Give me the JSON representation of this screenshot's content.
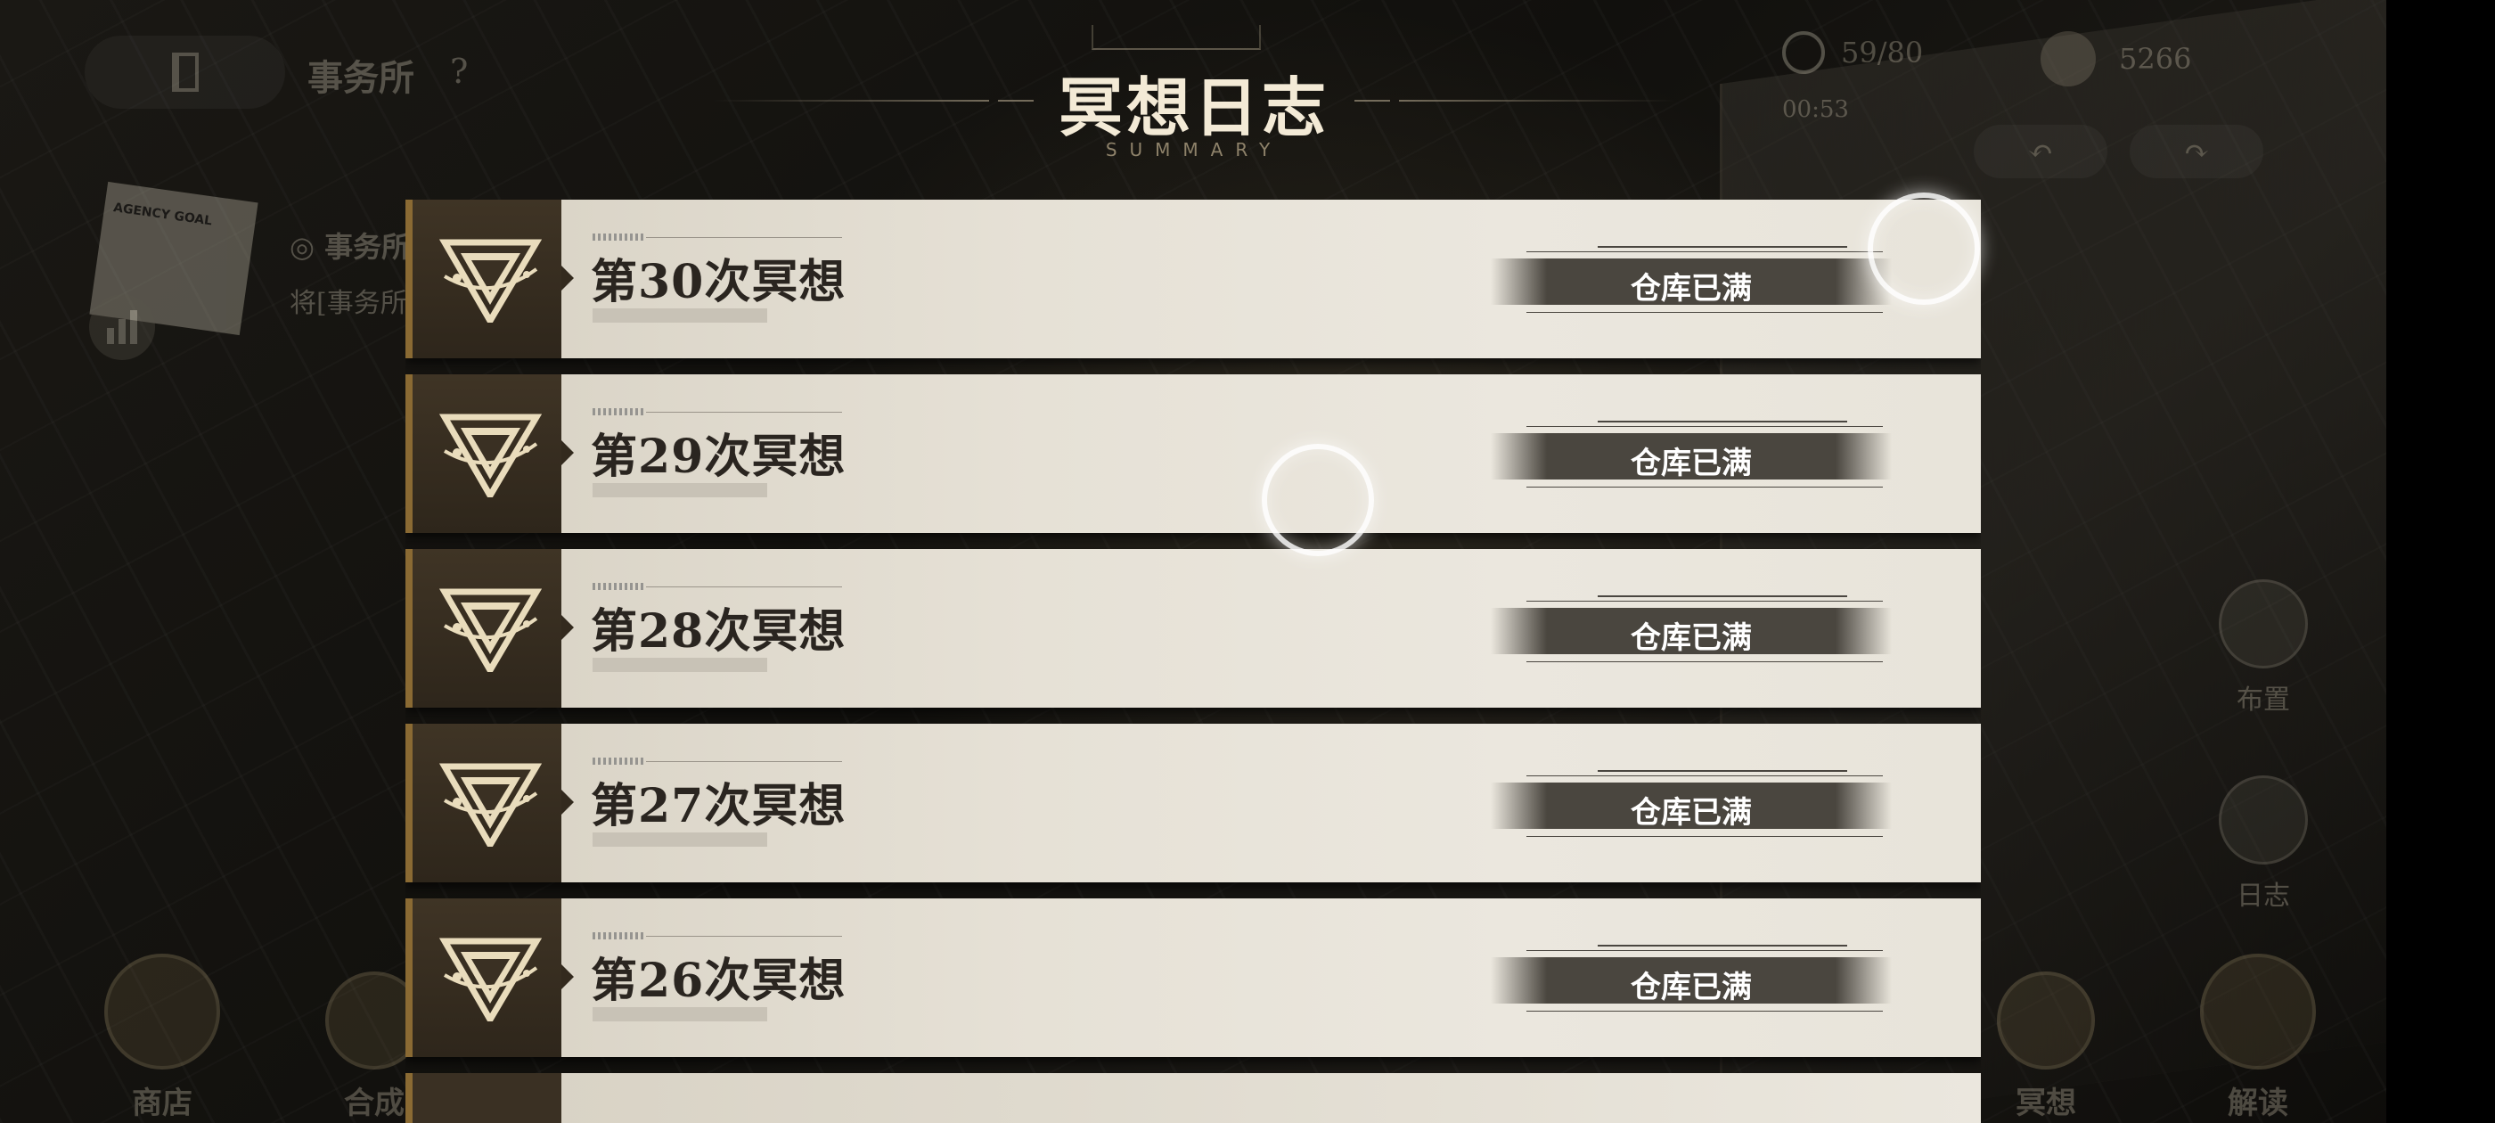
{
  "header": {
    "title": "冥想日志",
    "subtitle": "SUMMARY"
  },
  "hud": {
    "office_title": "事务所",
    "help_mark": "?",
    "energy": "59/80",
    "energy_timer": "00:53",
    "currency": "5266",
    "sticky_note": "AGENCY GOAL",
    "task_title": "事务所",
    "task_desc": "将[事务所"
  },
  "side_menu": {
    "layout_label": "布置",
    "log_label": "日志"
  },
  "bottom_menu": {
    "shop_label": "商店",
    "synth_label": "合成",
    "meditate_label": "冥想",
    "decode_label": "解读"
  },
  "meditations": [
    {
      "label": "第30次冥想",
      "status": "仓库已满"
    },
    {
      "label": "第29次冥想",
      "status": "仓库已满"
    },
    {
      "label": "第28次冥想",
      "status": "仓库已满"
    },
    {
      "label": "第27次冥想",
      "status": "仓库已满"
    },
    {
      "label": "第26次冥想",
      "status": "仓库已满"
    }
  ],
  "icons": {
    "row_emblem": "triangle-eye-emblem",
    "exit": "door-exit-icon",
    "energy": "energy-icon",
    "currency": "coin-icon"
  },
  "colors": {
    "row_bg": "#e6e1d6",
    "emblem_bg": "#3a3023",
    "emblem_accent": "#8a6a33",
    "status_bg": "#4a463f",
    "title": "#f3ead6"
  }
}
